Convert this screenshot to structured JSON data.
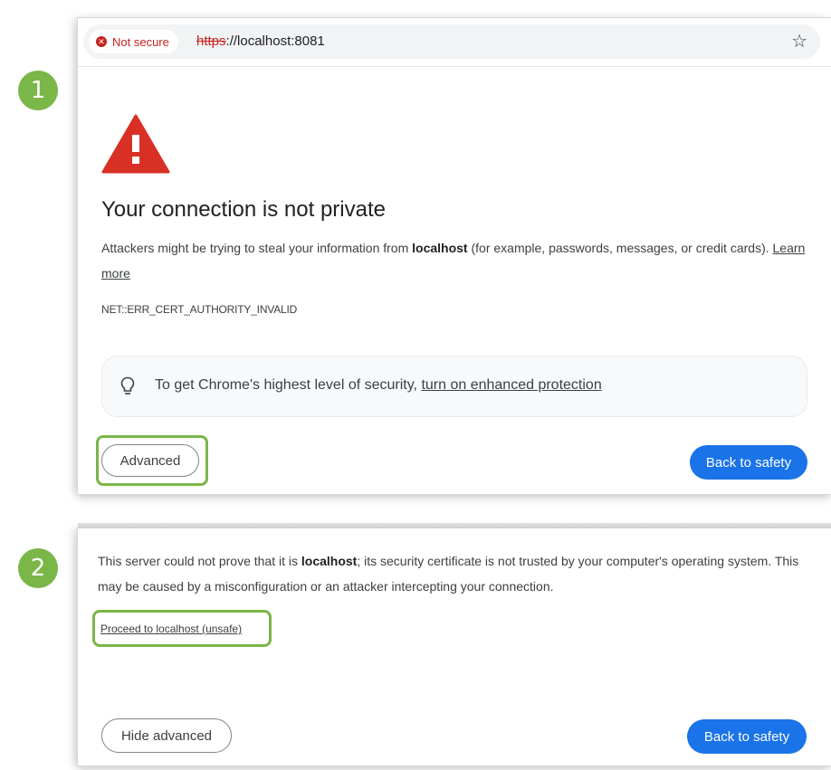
{
  "steps": {
    "one": "1",
    "two": "2"
  },
  "browser": {
    "security_label": "Not secure",
    "url_scheme": "https",
    "url_rest": "://localhost:8081",
    "star_icon": "star-outline-icon"
  },
  "interstitial": {
    "title": "Your connection is not private",
    "description_prefix": "Attackers might be trying to steal your information from ",
    "host": "localhost",
    "description_suffix": " (for example, passwords, messages, or credit cards). ",
    "learn_more": "Learn more",
    "error_code": "NET::ERR_CERT_AUTHORITY_INVALID",
    "enhanced_text": "To get Chrome's highest level of security, ",
    "enhanced_link": "turn on enhanced protection",
    "advanced_button": "Advanced",
    "back_button": "Back to safety"
  },
  "advanced": {
    "text_prefix": "This server could not prove that it is ",
    "host": "localhost",
    "text_suffix": "; its security certificate is not trusted by your computer's operating system. This may be caused by a misconfiguration or an attacker intercepting your connection.",
    "proceed_link": "Proceed to localhost (unsafe)",
    "hide_button": "Hide advanced",
    "back_button": "Back to safety"
  },
  "colors": {
    "highlight": "#7ab648",
    "danger": "#c5221f",
    "warning_red": "#d93025",
    "primary_button": "#1a73e8"
  }
}
